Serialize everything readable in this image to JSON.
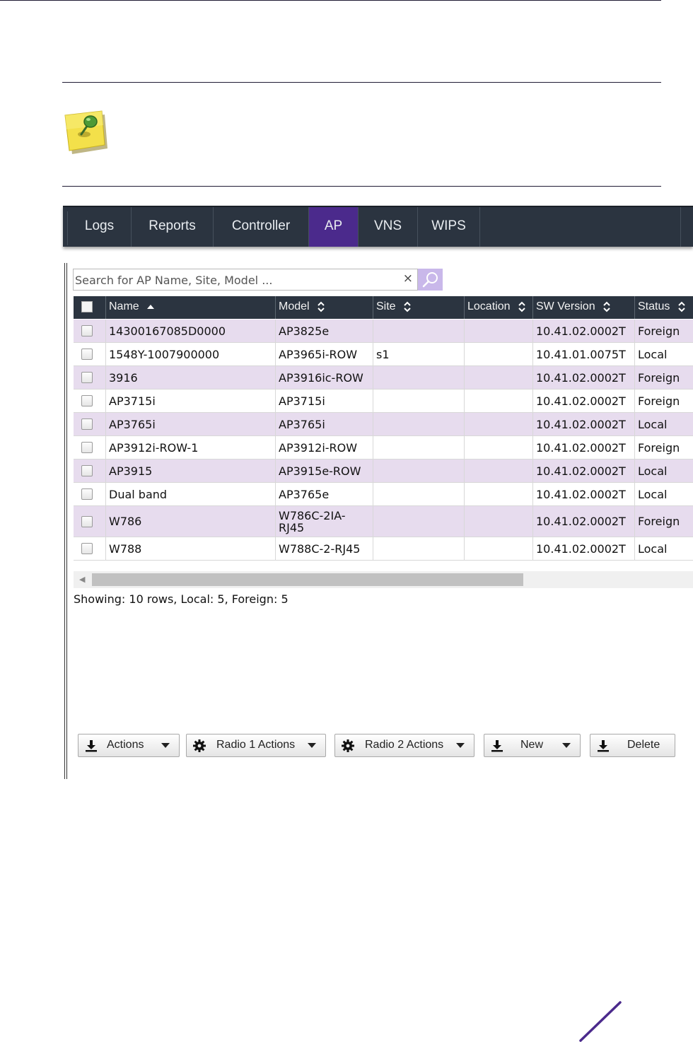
{
  "nav": {
    "tabs": [
      {
        "label": "Logs"
      },
      {
        "label": "Reports"
      },
      {
        "label": "Controller"
      },
      {
        "label": "AP",
        "active": true
      },
      {
        "label": "VNS"
      },
      {
        "label": "WIPS"
      }
    ]
  },
  "search": {
    "placeholder": "Search for AP Name, Site, Model ...",
    "clear_glyph": "×"
  },
  "table": {
    "columns": [
      "Name",
      "Model",
      "Site",
      "Location",
      "SW Version",
      "Status"
    ],
    "sort": {
      "column": "Name",
      "direction": "ascending"
    },
    "rows": [
      {
        "name": "14300167085D0000",
        "model": "AP3825e",
        "site": "",
        "location": "",
        "sw_version": "10.41.02.0002T",
        "status": "Foreign"
      },
      {
        "name": "1548Y-1007900000",
        "model": "AP3965i-ROW",
        "site": "s1",
        "location": "",
        "sw_version": "10.41.01.0075T",
        "status": "Local"
      },
      {
        "name": "3916",
        "model": "AP3916ic-ROW",
        "site": "",
        "location": "",
        "sw_version": "10.41.02.0002T",
        "status": "Foreign"
      },
      {
        "name": "AP3715i",
        "model": "AP3715i",
        "site": "",
        "location": "",
        "sw_version": "10.41.02.0002T",
        "status": "Foreign"
      },
      {
        "name": "AP3765i",
        "model": "AP3765i",
        "site": "",
        "location": "",
        "sw_version": "10.41.02.0002T",
        "status": "Local"
      },
      {
        "name": "AP3912i-ROW-1",
        "model": "AP3912i-ROW",
        "site": "",
        "location": "",
        "sw_version": "10.41.02.0002T",
        "status": "Foreign"
      },
      {
        "name": "AP3915",
        "model": "AP3915e-ROW",
        "site": "",
        "location": "",
        "sw_version": "10.41.02.0002T",
        "status": "Local"
      },
      {
        "name": "Dual band",
        "model": "AP3765e",
        "site": "",
        "location": "",
        "sw_version": "10.41.02.0002T",
        "status": "Local"
      },
      {
        "name": "W786",
        "model": "W786C-2IA-RJ45",
        "site": "",
        "location": "",
        "sw_version": "10.41.02.0002T",
        "status": "Foreign"
      },
      {
        "name": "W788",
        "model": "W788C-2-RJ45",
        "site": "",
        "location": "",
        "sw_version": "10.41.02.0002T",
        "status": "Local"
      }
    ]
  },
  "summary": "Showing: 10 rows, Local: 5, Foreign: 5",
  "buttons": [
    {
      "label": "Actions",
      "icon": "download-icon",
      "dropdown": true
    },
    {
      "label": "Radio 1 Actions",
      "icon": "gear-icon",
      "dropdown": true
    },
    {
      "label": "Radio 2 Actions",
      "icon": "gear-icon",
      "dropdown": true
    },
    {
      "label": "New",
      "icon": "download-icon",
      "dropdown": true
    },
    {
      "label": "Delete",
      "icon": "download-icon",
      "dropdown": false
    }
  ],
  "icons": {
    "note": "sticky-note-pushpin-icon",
    "search": "magnifier-icon",
    "sort_asc": "sort-ascending-icon",
    "sort_both": "sort-both-icon"
  },
  "colors": {
    "nav_bg": "#2b3440",
    "nav_active": "#4b2a8c",
    "row_alt": "#e7dcee",
    "search_button": "#c9b8ea",
    "accent": "#4b2a8c"
  }
}
